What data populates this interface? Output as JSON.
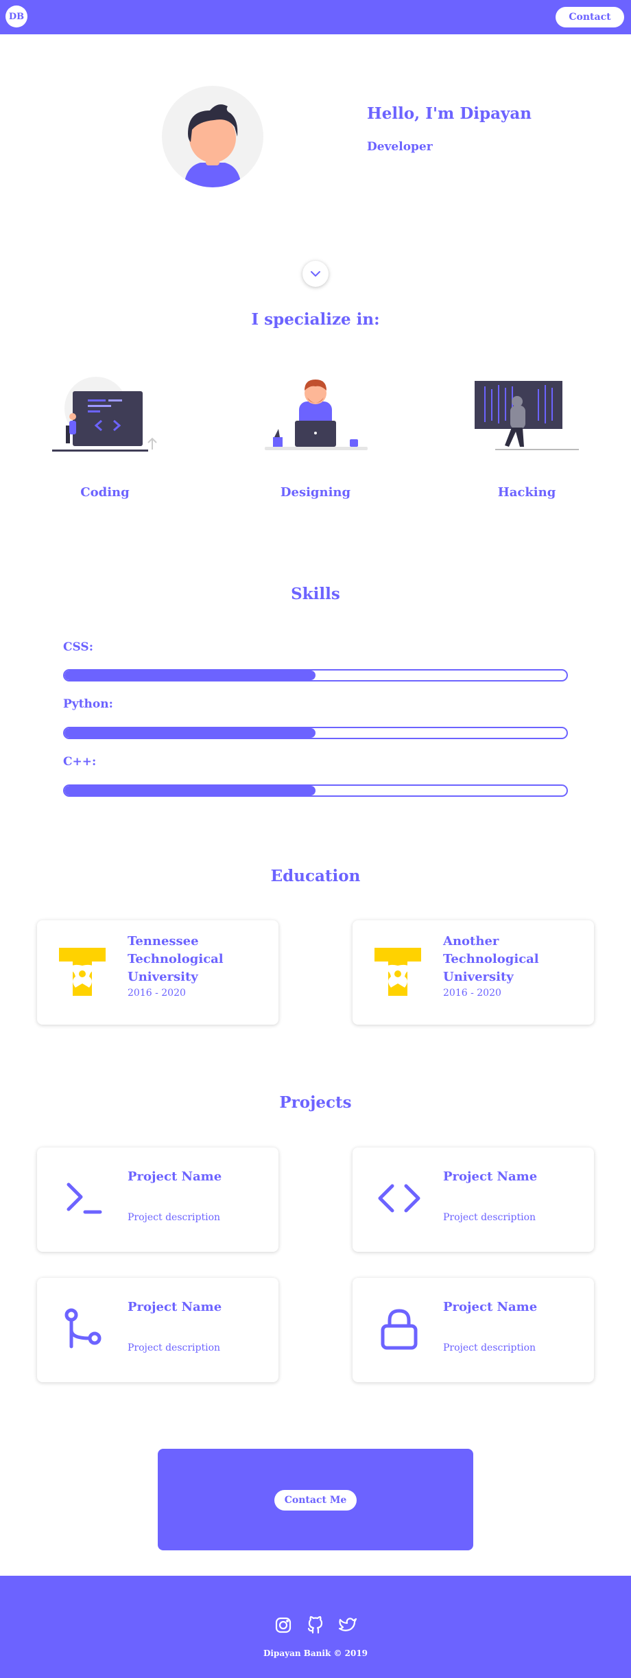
{
  "nav": {
    "logo": "DB",
    "contact_label": "Contact"
  },
  "hero": {
    "greeting": "Hello, I'm Dipayan",
    "role": "Developer"
  },
  "specialize": {
    "title": "I specialize in:",
    "items": [
      {
        "label": "Coding",
        "icon": "coding-illustration"
      },
      {
        "label": "Designing",
        "icon": "designing-illustration"
      },
      {
        "label": "Hacking",
        "icon": "hacking-illustration"
      }
    ]
  },
  "skills": {
    "title": "Skills",
    "items": [
      {
        "label": "CSS:",
        "level": 0.5
      },
      {
        "label": "Python:",
        "level": 0.5
      },
      {
        "label": "C++:",
        "level": 0.5
      }
    ]
  },
  "education": {
    "title": "Education",
    "items": [
      {
        "school": "Tennessee Technological University",
        "years": "2016 - 2020",
        "icon": "university-logo"
      },
      {
        "school": "Another Technological University",
        "years": "2016 - 2020",
        "icon": "university-logo"
      }
    ]
  },
  "projects": {
    "title": "Projects",
    "items": [
      {
        "name": "Project Name",
        "description": "Project description",
        "icon": "terminal-icon"
      },
      {
        "name": "Project Name",
        "description": "Project description",
        "icon": "code-icon"
      },
      {
        "name": "Project Name",
        "description": "Project description",
        "icon": "git-branch-icon"
      },
      {
        "name": "Project Name",
        "description": "Project description",
        "icon": "lock-icon"
      }
    ]
  },
  "contact": {
    "button_label": "Contact Me"
  },
  "footer": {
    "social": [
      "instagram-icon",
      "github-icon",
      "twitter-icon"
    ],
    "copyright": "Dipayan Banik © 2019"
  },
  "colors": {
    "accent": "#6c63ff",
    "background": "#ffffff",
    "university_yellow": "#ffd200",
    "dark_screen": "#3f3d56",
    "skin": "#fdb797"
  }
}
